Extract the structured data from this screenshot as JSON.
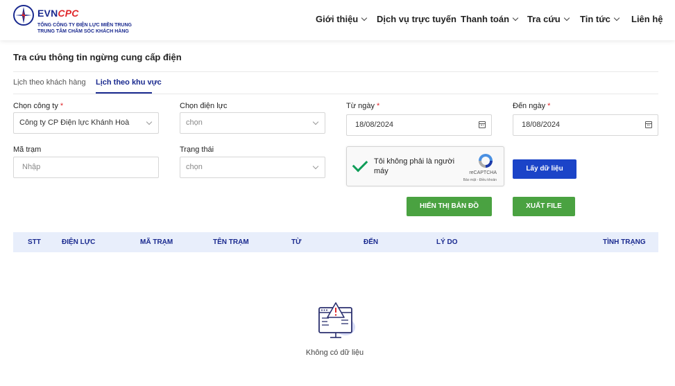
{
  "brand": {
    "evn": "EVN",
    "cpc": "CPC",
    "line1": "TỔNG CÔNG TY ĐIỆN LỰC MIỀN TRUNG",
    "line2": "TRUNG TÂM CHĂM SÓC KHÁCH HÀNG"
  },
  "nav": [
    {
      "label": "Giới thiệu",
      "dropdown": true
    },
    {
      "label": "Dịch vụ trực tuyến",
      "dropdown": false
    },
    {
      "label": "Thanh toán",
      "dropdown": true
    },
    {
      "label": "Tra cứu",
      "dropdown": true
    },
    {
      "label": "Tin tức",
      "dropdown": true
    },
    {
      "label": "Liên hệ",
      "dropdown": false
    }
  ],
  "page": {
    "title": "Tra cứu thông tin ngừng cung cấp điện"
  },
  "tabs": [
    {
      "label": "Lịch theo khách hàng",
      "active": false
    },
    {
      "label": "Lịch theo khu vực",
      "active": true
    }
  ],
  "form": {
    "company": {
      "label": "Chọn công ty",
      "value": "Công ty CP Điện lực Khánh Hoà"
    },
    "power_unit": {
      "label": "Chọn điện lực",
      "value": "chọn"
    },
    "from_date": {
      "label": "Từ ngày",
      "value": "18/08/2024"
    },
    "to_date": {
      "label": "Đến ngày",
      "value": "18/08/2024"
    },
    "station_code": {
      "label": "Mã trạm",
      "placeholder": "Nhập"
    },
    "status": {
      "label": "Trạng thái",
      "value": "chọn"
    },
    "required_mark": "*"
  },
  "captcha": {
    "text": "Tôi không phải là người máy",
    "brand": "reCAPTCHA",
    "links": "Bảo mật - Điều khoản"
  },
  "buttons": {
    "get_data": "Lấy dữ liệu",
    "show_map": "HIỂN THỊ BẢN ĐỒ",
    "export_file": "XUẤT FILE"
  },
  "table": {
    "columns": [
      "STT",
      "ĐIỆN LỰC",
      "MÃ TRẠM",
      "TÊN TRẠM",
      "TỪ",
      "ĐẾN",
      "LÝ DO",
      "TÌNH TRẠNG"
    ],
    "empty_text": "Không có dữ liệu"
  },
  "colors": {
    "primary": "#1a2a8f",
    "button_blue": "#1b44c8",
    "button_green": "#4aa241",
    "required": "#e0262a",
    "table_header_bg": "#e8eefb"
  }
}
